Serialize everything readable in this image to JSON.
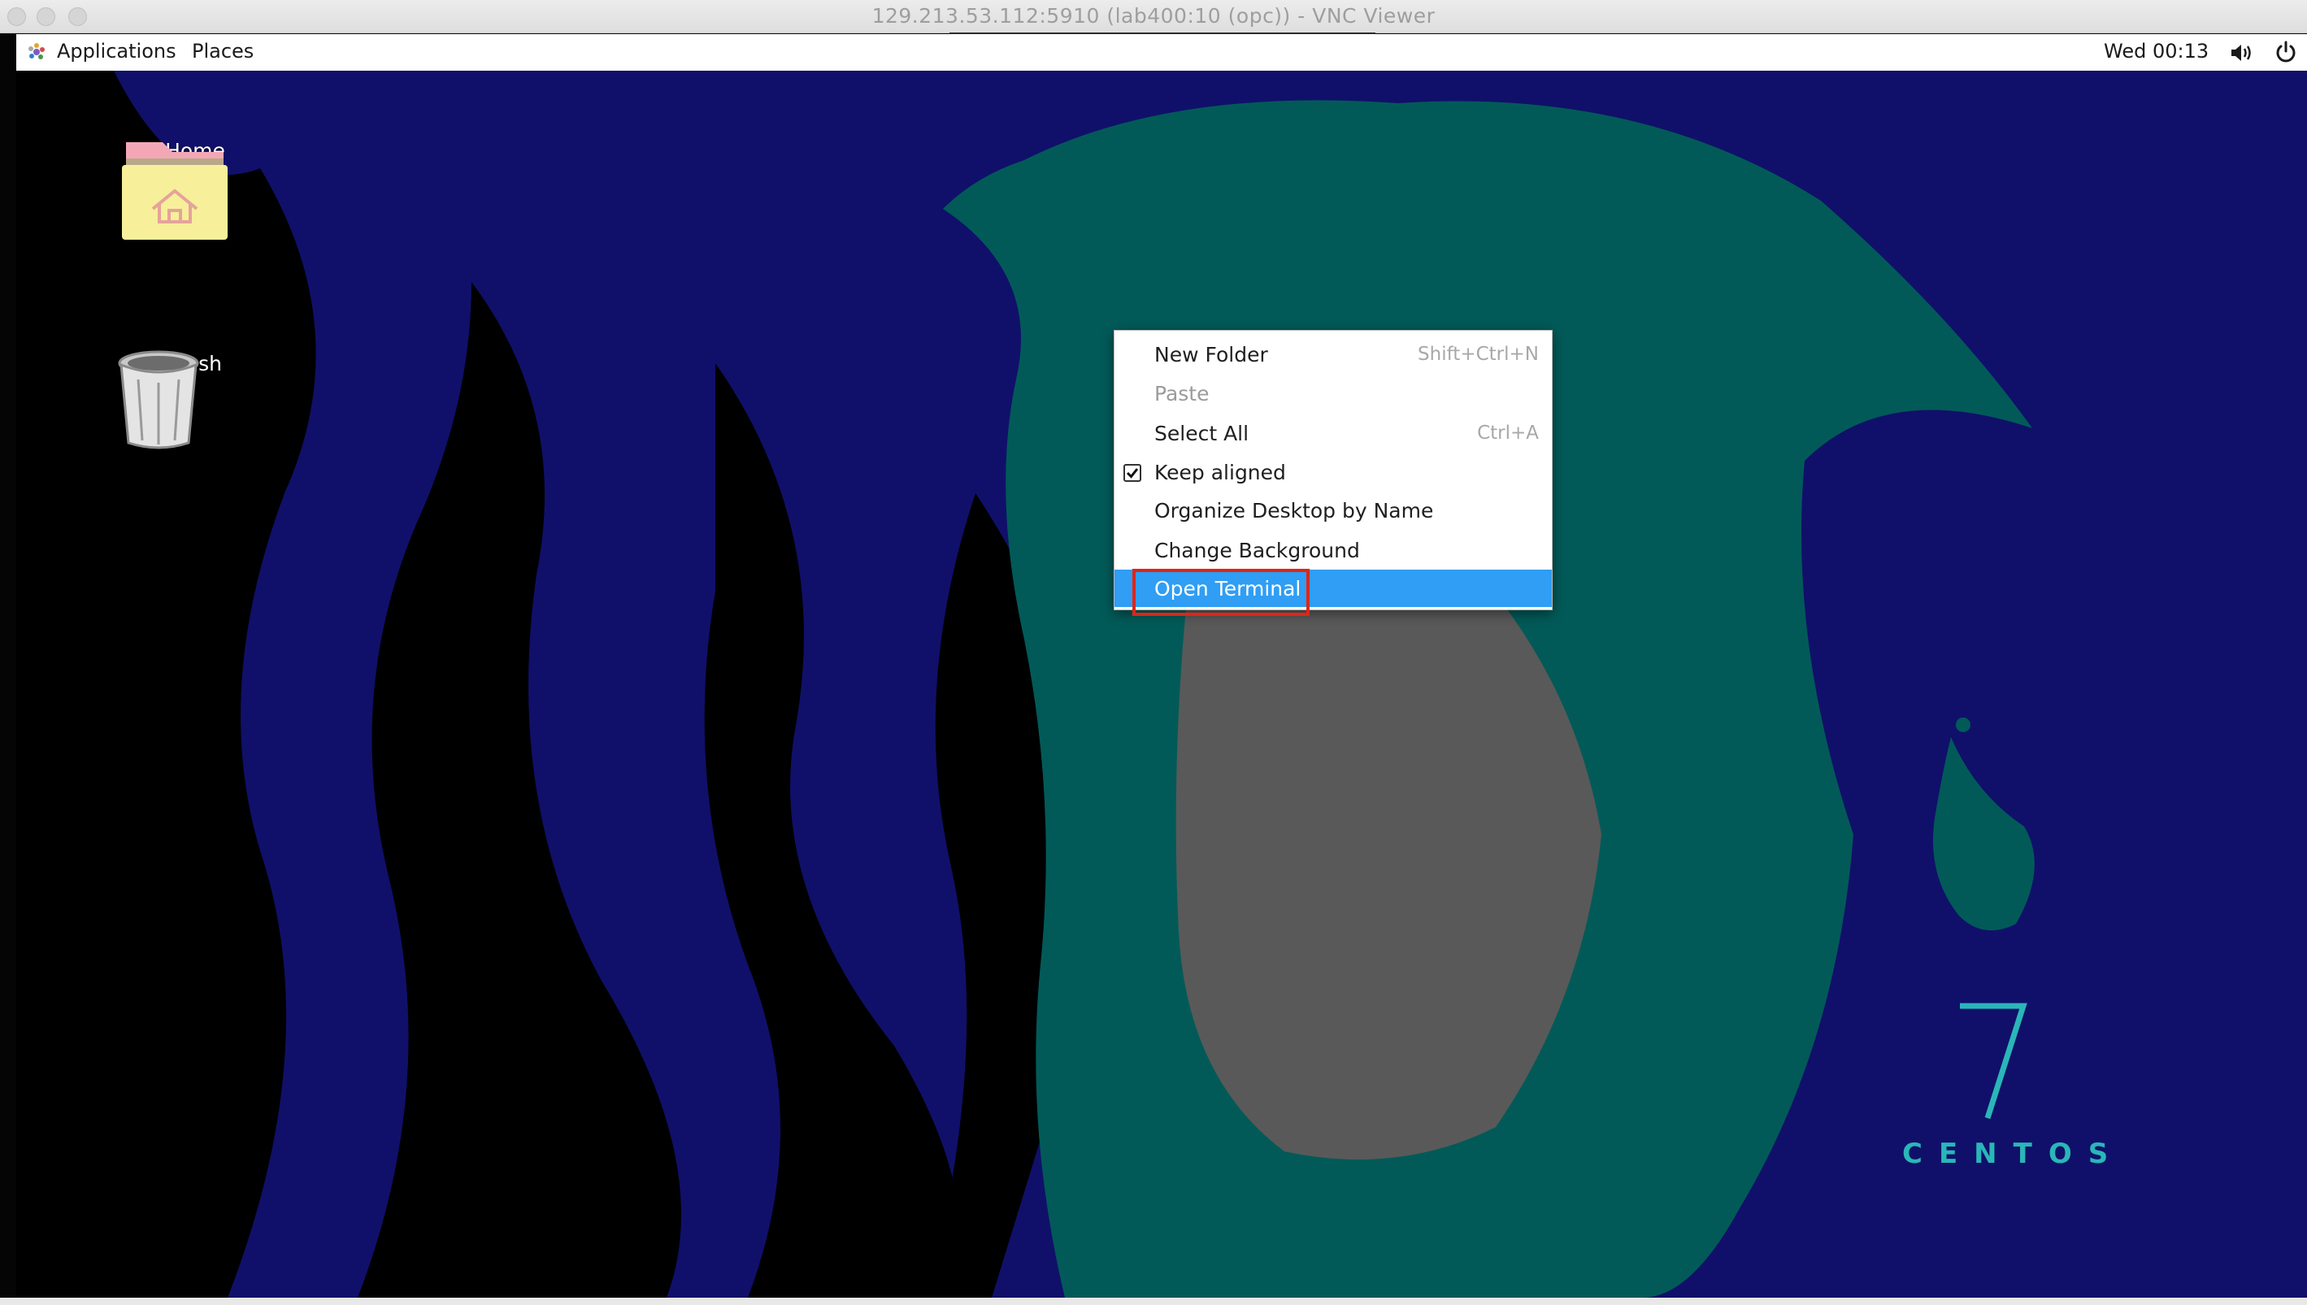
{
  "window": {
    "title": "129.213.53.112:5910 (lab400:10 (opc)) - VNC Viewer",
    "controls": [
      "close-button",
      "minimize-button",
      "zoom-button"
    ]
  },
  "panel": {
    "applications_label": "Applications",
    "places_label": "Places",
    "clock": "Wed 00:13",
    "icons": [
      "gnome-foot-icon",
      "volume-icon",
      "power-icon"
    ]
  },
  "desktop": {
    "icons": [
      {
        "label": "Home",
        "icon": "home-folder-icon"
      },
      {
        "label": "Trash",
        "icon": "trash-icon"
      }
    ],
    "branding": {
      "number": "7",
      "word": "CENTOS"
    }
  },
  "context_menu": {
    "items": [
      {
        "label": "New Folder",
        "accelerator": "Shift+Ctrl+N",
        "enabled": true
      },
      {
        "label": "Paste",
        "accelerator": "",
        "enabled": false
      },
      {
        "label": "Select All",
        "accelerator": "Ctrl+A",
        "enabled": true
      },
      {
        "label": "Keep aligned",
        "accelerator": "",
        "enabled": true,
        "checked": true
      },
      {
        "label": "Organize Desktop by Name",
        "accelerator": "",
        "enabled": true
      },
      {
        "label": "Change Background",
        "accelerator": "",
        "enabled": true
      },
      {
        "label": "Open Terminal",
        "accelerator": "",
        "enabled": true,
        "selected": true
      }
    ]
  },
  "colors": {
    "menu_selection": "#2f9ef4",
    "annotation_box": "#e02418",
    "desktop_navy": "#10106a",
    "desktop_teal": "#025a58",
    "desktop_gray": "#595959",
    "centos_accent": "#2ab6b8"
  }
}
